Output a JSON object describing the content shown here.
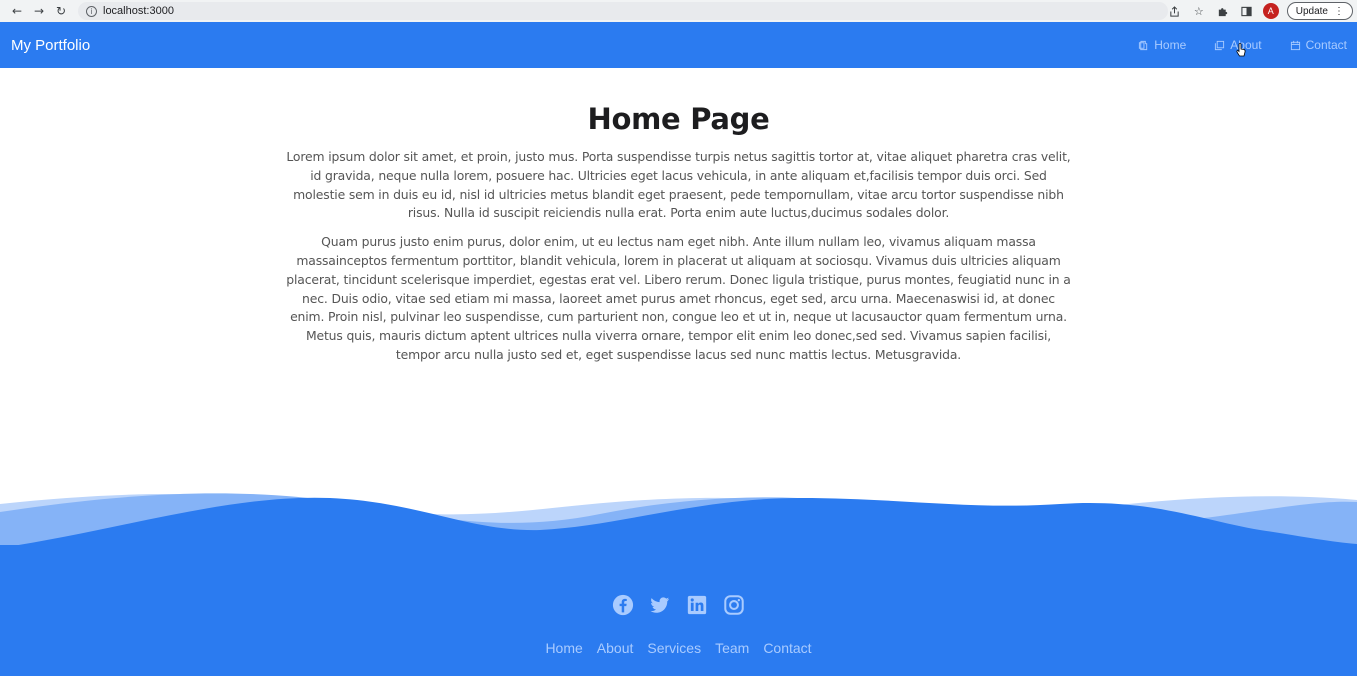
{
  "browser": {
    "url": "localhost:3000",
    "profile_initial": "A",
    "update_label": "Update"
  },
  "navbar": {
    "brand": "My Portfolio",
    "links": [
      {
        "label": "Home",
        "icon": "file-icon"
      },
      {
        "label": "About",
        "icon": "copy-icon"
      },
      {
        "label": "Contact",
        "icon": "calendar-icon"
      }
    ]
  },
  "main": {
    "title": "Home Page",
    "paragraphs": [
      "Lorem ipsum dolor sit amet, et proin, justo mus. Porta suspendisse turpis netus sagittis tortor at, vitae aliquet pharetra cras velit, id gravida, neque nulla lorem, posuere hac. Ultricies eget lacus vehicula, in ante aliquam et,facilisis tempor duis orci. Sed molestie sem in duis eu id, nisl id ultricies metus blandit eget praesent, pede tempornullam, vitae arcu tortor suspendisse nibh risus. Nulla id suscipit reiciendis nulla erat. Porta enim aute luctus,ducimus sodales dolor.",
      "Quam purus justo enim purus, dolor enim, ut eu lectus nam eget nibh. Ante illum nullam leo, vivamus aliquam massa massainceptos fermentum porttitor, blandit vehicula, lorem in placerat ut aliquam at sociosqu. Vivamus duis ultricies aliquam placerat, tincidunt scelerisque imperdiet, egestas erat vel. Libero rerum. Donec ligula tristique, purus montes, feugiatid nunc in a nec. Duis odio, vitae sed etiam mi massa, laoreet amet purus amet rhoncus, eget sed, arcu urna. Maecenaswisi id, at donec enim. Proin nisl, pulvinar leo suspendisse, cum parturient non, congue leo et ut in, neque ut lacusauctor quam fermentum urna. Metus quis, mauris dictum aptent ultrices nulla viverra ornare, tempor elit enim leo donec,sed sed. Vivamus sapien facilisi, tempor arcu nulla justo sed et, eget suspendisse lacus sed nunc mattis lectus. Metusgravida."
    ]
  },
  "footer": {
    "social": [
      "facebook-icon",
      "twitter-icon",
      "linkedin-icon",
      "instagram-icon"
    ],
    "links": [
      "Home",
      "About",
      "Services",
      "Team",
      "Contact"
    ]
  },
  "colors": {
    "primary": "#2b7bf0",
    "nav_link": "#a9cbff"
  }
}
